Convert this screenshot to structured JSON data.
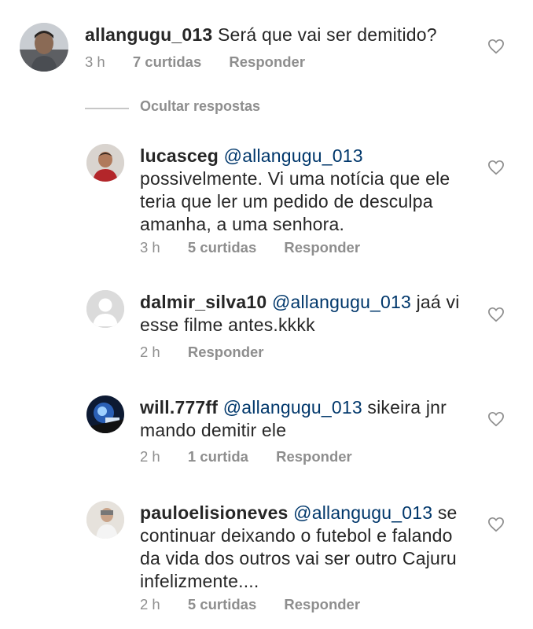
{
  "comments": [
    {
      "username": "allangugu_013",
      "mention": "",
      "text": "Será que vai ser demitido?",
      "time": "3 h",
      "likes": "7 curtidas",
      "reply": "Responder"
    },
    {
      "username": "lucasceg",
      "mention": "@allangugu_013",
      "text_line1": "possivelmente. Vi uma notícia que ele",
      "text_line2": "teria que ler um pedido de desculpa",
      "text_line3": "amanha, a uma senhora.",
      "time": "3 h",
      "likes": "5 curtidas",
      "reply": "Responder"
    },
    {
      "username": "dalmir_silva10",
      "mention": "@allangugu_013",
      "text_inline": "jaá vi",
      "text_line2": "esse filme antes.kkkk",
      "time": "2 h",
      "reply": "Responder"
    },
    {
      "username": "will.777ff",
      "mention": "@allangugu_013",
      "text_inline": "sikeira jnr",
      "text_line2": "mando demitir ele",
      "time": "2 h",
      "likes": "1 curtida",
      "reply": "Responder"
    },
    {
      "username": "pauloelisioneves",
      "mention": "@allangugu_013",
      "text_inline": "se",
      "text_line2": "continuar deixando o futebol e falando",
      "text_line3": "da vida dos outros vai ser outro Cajuru",
      "text_line4": "infelizmente....",
      "time": "2 h",
      "likes": "5 curtidas",
      "reply": "Responder"
    }
  ],
  "hide_replies": "Ocultar respostas",
  "icons": {
    "like": "heart-outline-icon"
  },
  "colors": {
    "text": "#262626",
    "muted": "#8e8e8e",
    "mention": "#00376b"
  }
}
